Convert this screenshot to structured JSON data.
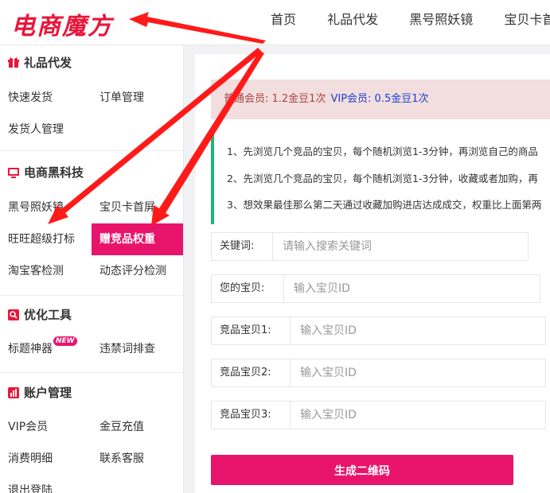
{
  "header": {
    "logo": "电商魔方",
    "nav": [
      "首页",
      "礼品代发",
      "黑号照妖镜",
      "宝贝卡首"
    ]
  },
  "sidebar": {
    "sections": [
      {
        "title": "礼品代发",
        "icon": "gift-icon",
        "items": [
          "快速发货",
          "订单管理",
          "发货人管理"
        ]
      },
      {
        "title": "电商黑科技",
        "icon": "screen-icon",
        "items": [
          "黑号照妖镜",
          "宝贝卡首屏",
          "旺旺超级打标",
          "赠竞品权重",
          "淘宝客检测",
          "动态评分检测"
        ]
      },
      {
        "title": "优化工具",
        "icon": "search-doc-icon",
        "items": [
          "标题神器",
          "违禁词排查"
        ]
      },
      {
        "title": "账户管理",
        "icon": "bar-chart-icon",
        "items": [
          "VIP会员",
          "金豆充值",
          "消费明细",
          "联系客服",
          "退出登陆"
        ]
      }
    ],
    "active_item": "赠竞品权重",
    "new_badge": "NEW"
  },
  "notice": {
    "normal": "普通会员: 1.2金豆1次",
    "vip": "VIP会员: 0.5金豆1次"
  },
  "tips": [
    "1、先浏览几个竞品的宝贝，每个随机浏览1-3分钟，再浏览自己的商品",
    "2、先浏览几个竞品的宝贝，每个随机浏览1-3分钟，收藏或者加购，再",
    "3、想效果最佳那么第二天通过收藏加购进店达成成交，权重比上面第两"
  ],
  "form": {
    "keyword_label": "关键词:",
    "keyword_placeholder": "请输入搜索关键词",
    "mine_label": "您的宝贝:",
    "mine_placeholder": "输入宝贝ID",
    "comp1_label": "竞品宝贝1:",
    "comp1_placeholder": "输入宝贝ID",
    "comp2_label": "竞品宝贝2:",
    "comp2_placeholder": "输入宝贝ID",
    "comp3_label": "竞品宝贝3:",
    "comp3_placeholder": "输入宝贝ID",
    "submit": "生成二维码"
  },
  "colors": {
    "brand_red": "#e8163a",
    "accent_pink": "#e8146b",
    "tip_border": "#1ab67a",
    "notice_bg": "#f2dede",
    "vip_blue": "#1b3fd0",
    "arrow_red": "#ff1a1a"
  }
}
